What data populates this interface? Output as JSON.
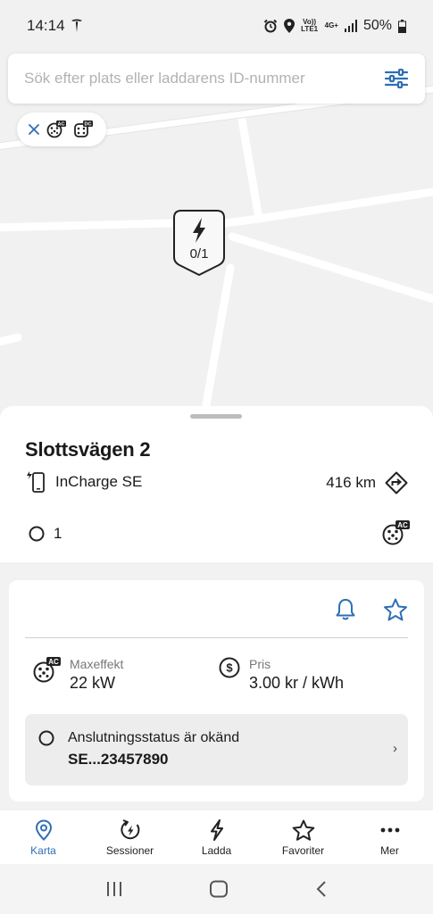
{
  "status_bar": {
    "time": "14:14",
    "volte": "Vo)) LTE1",
    "network": "4G+",
    "battery": "50%"
  },
  "search": {
    "placeholder": "Sök efter plats eller laddarens ID-nummer"
  },
  "filter_chip": {
    "connector_types": [
      "AC",
      "DC"
    ]
  },
  "map_marker": {
    "availability": "0/1"
  },
  "station": {
    "name": "Slottsvägen 2",
    "operator": "InCharge SE",
    "distance": "416 km",
    "available_count": "1",
    "connector_type": "AC"
  },
  "details": {
    "max_power_label": "Maxeffekt",
    "max_power_value": "22 kW",
    "price_label": "Pris",
    "price_value": "3.00 kr / kWh",
    "connector_status": "Anslutningsstatus är okänd",
    "connector_id": "SE...23457890"
  },
  "nav": [
    {
      "label": "Karta",
      "icon": "map-pin-icon"
    },
    {
      "label": "Sessioner",
      "icon": "sessions-icon"
    },
    {
      "label": "Ladda",
      "icon": "bolt-icon"
    },
    {
      "label": "Favoriter",
      "icon": "star-icon"
    },
    {
      "label": "Mer",
      "icon": "more-icon"
    }
  ],
  "colors": {
    "accent": "#2f6fb5",
    "text": "#1a1a1a"
  }
}
